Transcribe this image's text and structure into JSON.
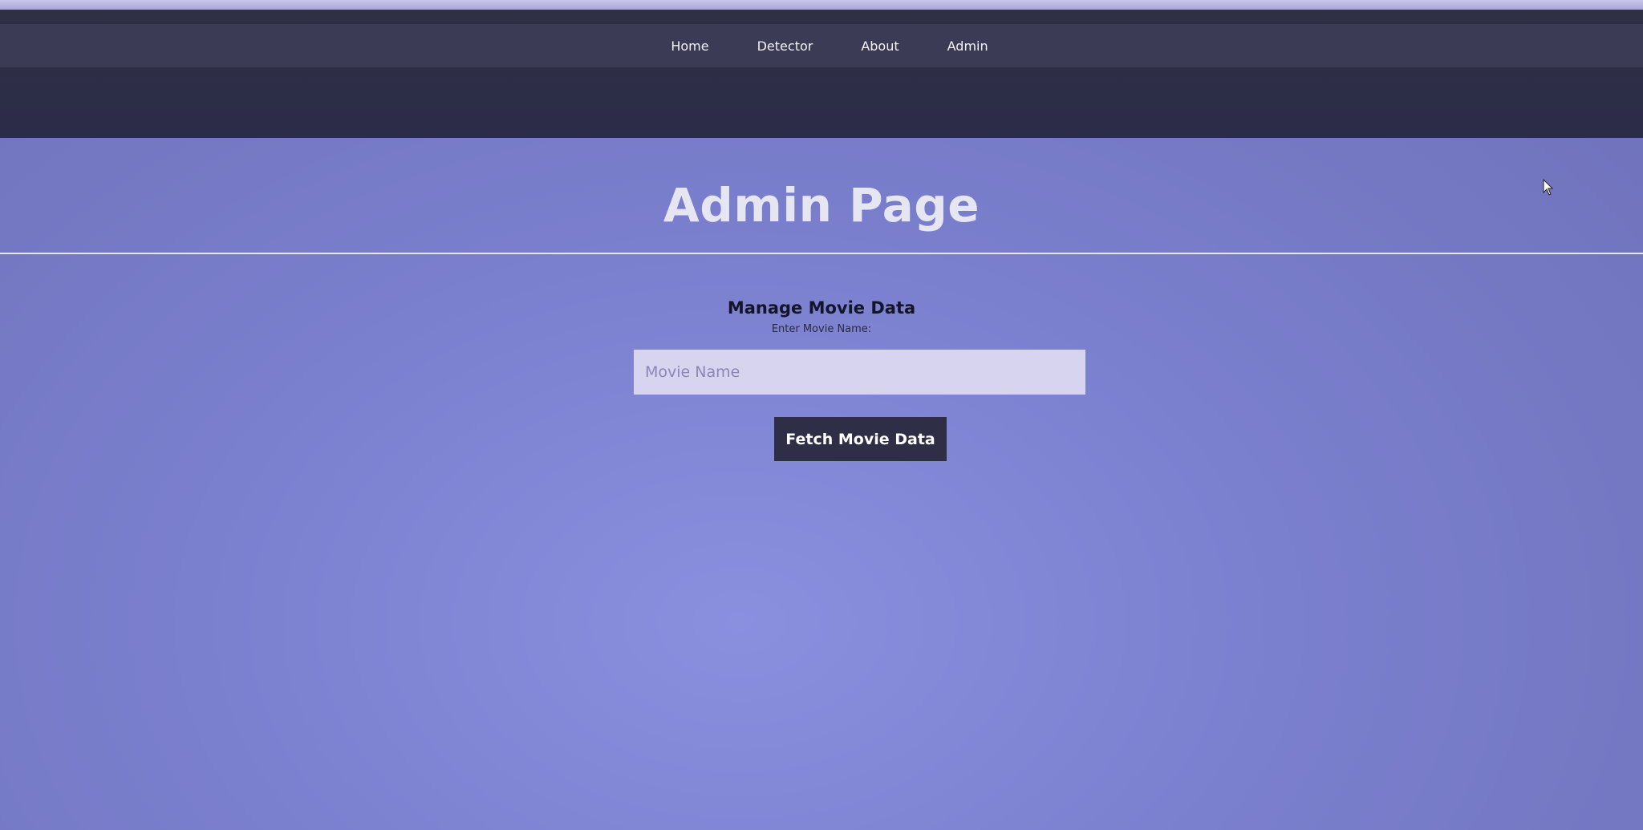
{
  "nav": {
    "items": [
      {
        "label": "Home"
      },
      {
        "label": "Detector"
      },
      {
        "label": "About"
      },
      {
        "label": "Admin"
      }
    ]
  },
  "page": {
    "title": "Admin Page"
  },
  "manage": {
    "heading": "Manage Movie Data",
    "label": "Enter Movie Name:",
    "input_placeholder": "Movie Name",
    "input_value": "",
    "button_label": "Fetch Movie Data"
  },
  "icons": {
    "cursor": "mouse-pointer-icon"
  },
  "colors": {
    "background": "#7b80cf",
    "navbar": "#3b3b55",
    "header_band": "#2b2c48",
    "button": "#2e2f46",
    "title_text": "#e6e6f2"
  }
}
